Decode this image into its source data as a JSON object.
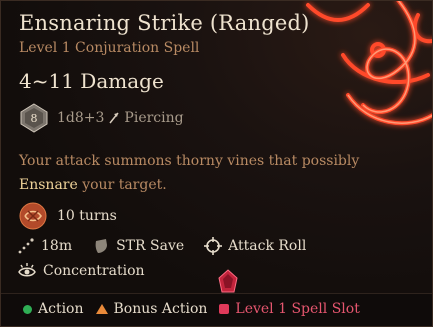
{
  "spell": {
    "title": "Ensnaring Strike (Ranged)",
    "subtitle": "Level 1 Conjuration Spell",
    "damage": "4~11 Damage",
    "dice": "1d8+3",
    "damage_type": "Piercing",
    "die_face": "8",
    "description_pre": "Your attack summons thorny vines that possibly ",
    "description_keyword": "Ensnare",
    "description_post": " your target.",
    "duration": "10 turns"
  },
  "stats": {
    "range": "18m",
    "save": "STR Save",
    "attack": "Attack Roll",
    "concentration": "Concentration"
  },
  "costs": {
    "action": "Action",
    "bonus_action": "Bonus Action",
    "spell_slot": "Level 1 Spell Slot"
  },
  "colors": {
    "title": "#efe3cf",
    "subtitle": "#b88a63",
    "keyword": "#f0d49a",
    "action": "#2fae55",
    "bonus_action": "#e98a3a",
    "spell_slot": "#e03a5a"
  },
  "icons": [
    "sigil-icon",
    "d8-die-icon",
    "arrow-icon",
    "thorn-vine-icon",
    "range-icon",
    "shield-icon",
    "crosshair-icon",
    "concentration-icon",
    "action-dot-icon",
    "bonus-action-triangle-icon",
    "spell-slot-square-icon",
    "spell-slot-gem-icon"
  ]
}
